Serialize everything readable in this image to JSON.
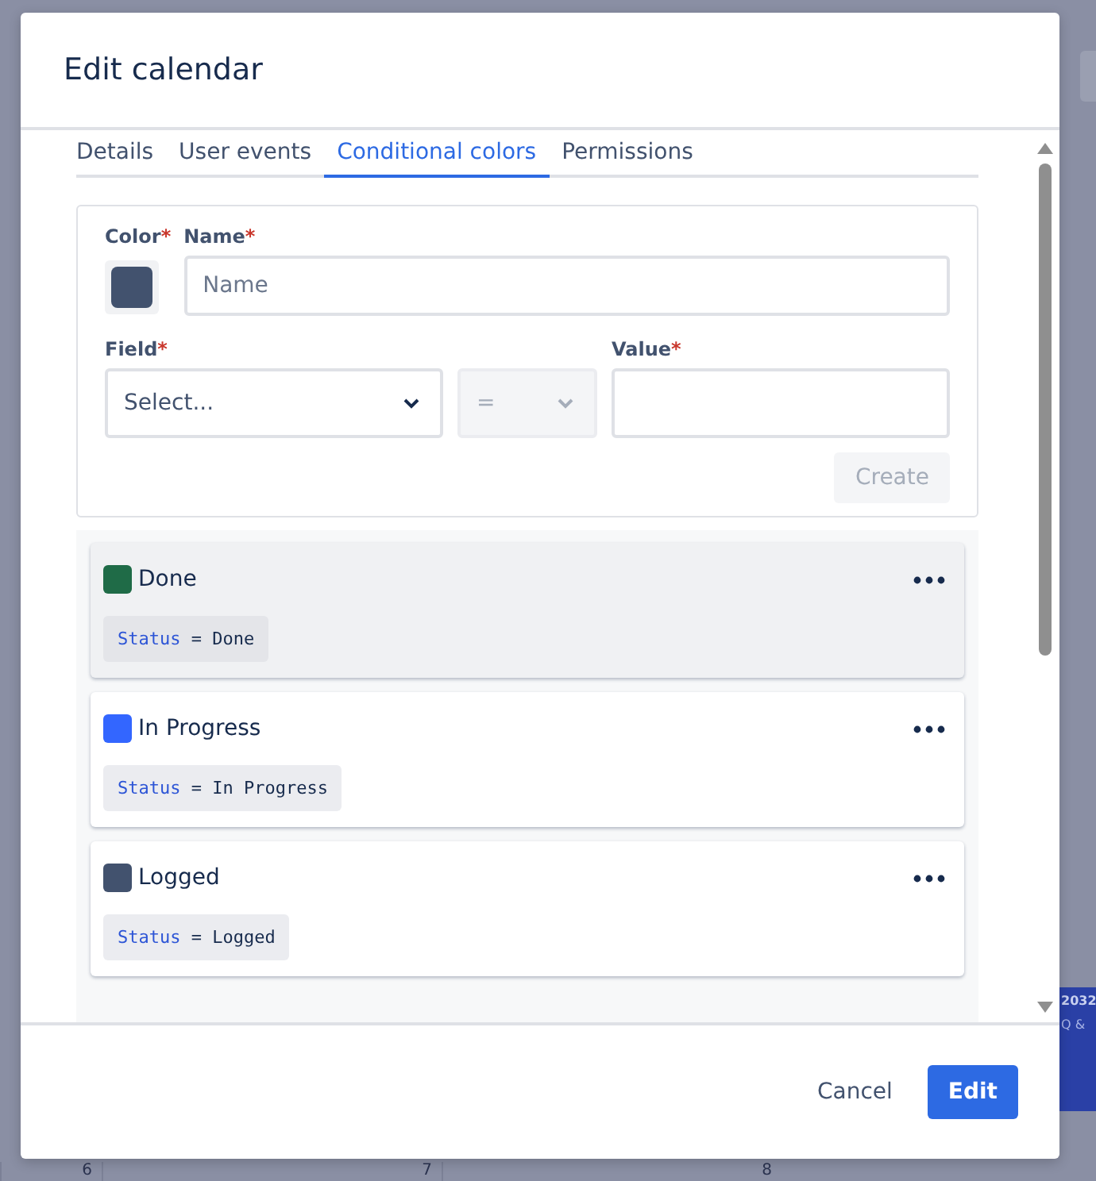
{
  "background": {
    "day_numbers": [
      "6",
      "7",
      "8"
    ],
    "event": {
      "title": "2032",
      "subtitle": "Q &"
    }
  },
  "dialog": {
    "title": "Edit calendar",
    "tabs": [
      {
        "label": "Details",
        "selected": false
      },
      {
        "label": "User events",
        "selected": false
      },
      {
        "label": "Conditional colors",
        "selected": true
      },
      {
        "label": "Permissions",
        "selected": false
      }
    ],
    "form": {
      "color_label": "Color",
      "color_required": "*",
      "name_label": "Name",
      "name_required": "*",
      "field_required": "*",
      "value_required": "*",
      "name_placeholder": "Name",
      "color": "#42526e",
      "field_label": "Field",
      "field_placeholder": "Select...",
      "operator": "=",
      "operator_disabled": true,
      "value_label": "Value",
      "create_button": "Create",
      "create_disabled": true
    },
    "conditions": [
      {
        "name": "Done",
        "color": "#1f6b47",
        "field": "Status",
        "operator": "=",
        "value": "Done",
        "selected": true
      },
      {
        "name": "In Progress",
        "color": "#3366ff",
        "field": "Status",
        "operator": "=",
        "value": "In Progress",
        "selected": false
      },
      {
        "name": "Logged",
        "color": "#42526e",
        "field": "Status",
        "operator": "=",
        "value": "Logged",
        "selected": false
      }
    ],
    "buttons": {
      "cancel": "Cancel",
      "confirm": "Edit"
    }
  }
}
